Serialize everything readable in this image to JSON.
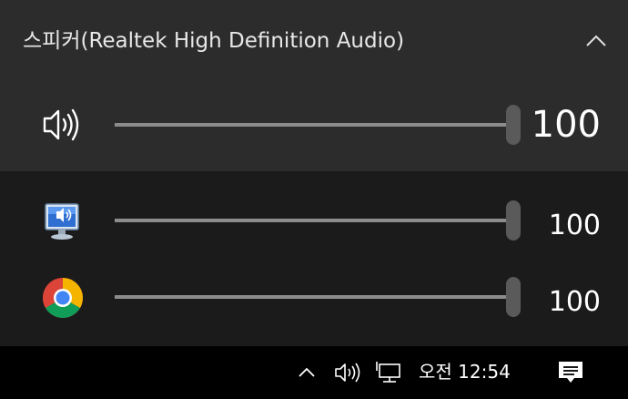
{
  "device": {
    "name": "스피커(Realtek High Definition Audio)",
    "expanded": true,
    "chevron_icon": "chevron-up-icon"
  },
  "master": {
    "icon": "speaker-volume-icon",
    "value_label": "100",
    "level": 1.0
  },
  "apps": [
    {
      "name": "system-sounds",
      "icon": "system-sounds-icon",
      "value_label": "100",
      "level": 1.0
    },
    {
      "name": "chrome",
      "icon": "chrome-icon",
      "value_label": "100",
      "level": 1.0
    }
  ],
  "taskbar": {
    "icons": [
      "chevron-up-icon",
      "speaker-icon",
      "network-icon"
    ],
    "clock": "오전 12:54",
    "notification_icon": "action-center-icon"
  },
  "colors": {
    "master_bg": "#2c2c2c",
    "apps_bg": "#1b1b1b",
    "taskbar_bg": "#000000",
    "slider_track": "#4a4a4a",
    "slider_fill": "#8c8c8c",
    "slider_thumb": "#5a5a5a"
  }
}
